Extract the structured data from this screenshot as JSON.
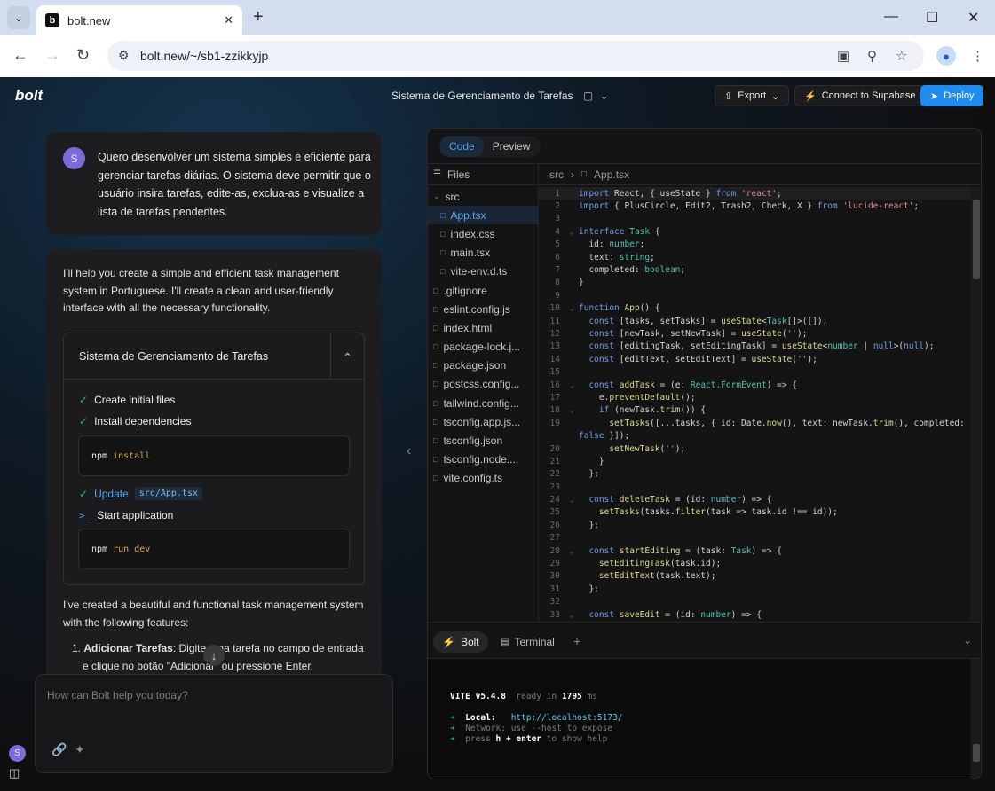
{
  "browser": {
    "tab_title": "bolt.new",
    "favicon_letter": "b",
    "url": "bolt.new/~/sb1-zzikkyjp",
    "new_tab_symbol": "+",
    "profile_initial": "●"
  },
  "app": {
    "logo": "bolt",
    "project_title": "Sistema de Gerenciamento de Tarefas",
    "export_label": "Export",
    "supabase_label": "Connect to Supabase",
    "deploy_label": "Deploy"
  },
  "chat": {
    "user_initial": "S",
    "user_message": "Quero desenvolver um sistema simples e eficiente para gerenciar tarefas diárias. O sistema deve permitir que o usuário insira tarefas, edite-as, exclua-as e visualize a lista de tarefas pendentes.",
    "assistant_intro": "I'll help you create a simple and efficient task management system in Portuguese. I'll create a clean and user-friendly interface with all the necessary functionality.",
    "artifact": {
      "title": "Sistema de Gerenciamento de Tarefas",
      "steps": [
        {
          "label": "Create initial files",
          "status": "done"
        },
        {
          "label": "Install dependencies",
          "status": "done"
        },
        {
          "label": "Update",
          "file": "src/App.tsx",
          "status": "done"
        },
        {
          "label": "Start application",
          "status": "running"
        }
      ],
      "cmd1": {
        "cmd": "npm",
        "args": "install"
      },
      "cmd2": {
        "cmd": "npm",
        "args": "run dev"
      }
    },
    "assistant_after": "I've created a beautiful and functional task management system with the following features:",
    "feature1_bold": "Adicionar Tarefas",
    "feature1_text": ": Digite uma tarefa no campo de entrada e clique no botão \"Adicionar\" ou pressione Enter.",
    "input_placeholder": "How can Bolt help you today?",
    "bottom_avatar": "S"
  },
  "workbench": {
    "tabs": [
      "Code",
      "Preview"
    ],
    "active_tab": "Code",
    "files_label": "Files",
    "tree": [
      {
        "name": "src",
        "type": "folder",
        "indent": 0
      },
      {
        "name": "App.tsx",
        "type": "file",
        "indent": 1,
        "selected": true
      },
      {
        "name": "index.css",
        "type": "file",
        "indent": 1
      },
      {
        "name": "main.tsx",
        "type": "file",
        "indent": 1
      },
      {
        "name": "vite-env.d.ts",
        "type": "file",
        "indent": 1
      },
      {
        "name": ".gitignore",
        "type": "file",
        "indent": 0
      },
      {
        "name": "eslint.config.js",
        "type": "file",
        "indent": 0
      },
      {
        "name": "index.html",
        "type": "file",
        "indent": 0
      },
      {
        "name": "package-lock.j...",
        "type": "file",
        "indent": 0
      },
      {
        "name": "package.json",
        "type": "file",
        "indent": 0
      },
      {
        "name": "postcss.config...",
        "type": "file",
        "indent": 0
      },
      {
        "name": "tailwind.config...",
        "type": "file",
        "indent": 0
      },
      {
        "name": "tsconfig.app.js...",
        "type": "file",
        "indent": 0
      },
      {
        "name": "tsconfig.json",
        "type": "file",
        "indent": 0
      },
      {
        "name": "tsconfig.node....",
        "type": "file",
        "indent": 0
      },
      {
        "name": "vite.config.ts",
        "type": "file",
        "indent": 0
      }
    ],
    "breadcrumb": [
      "src",
      "App.tsx"
    ],
    "code_lines": [
      {
        "n": "1",
        "html": "<span class='kw'>import</span> React, { useState } <span class='kw'>from</span> <span class='str'>'react'</span>;",
        "fold": ""
      },
      {
        "n": "2",
        "html": "<span class='kw'>import</span> { PlusCircle, Edit2, Trash2, Check, X } <span class='kw'>from</span> <span class='str'>'lucide-react'</span>;",
        "fold": ""
      },
      {
        "n": "3",
        "html": "",
        "fold": ""
      },
      {
        "n": "4",
        "html": "<span class='kw'>interface</span> <span class='ty'>Task</span> {",
        "fold": "v"
      },
      {
        "n": "5",
        "html": "  id: <span class='ty'>number</span>;",
        "fold": ""
      },
      {
        "n": "6",
        "html": "  text: <span class='ty'>string</span>;",
        "fold": ""
      },
      {
        "n": "7",
        "html": "  completed: <span class='ty'>boolean</span>;",
        "fold": ""
      },
      {
        "n": "8",
        "html": "}",
        "fold": ""
      },
      {
        "n": "9",
        "html": "",
        "fold": ""
      },
      {
        "n": "10",
        "html": "<span class='kw'>function</span> <span class='fn'>App</span>() {",
        "fold": "v"
      },
      {
        "n": "11",
        "html": "  <span class='kw'>const</span> [tasks, setTasks] = <span class='fn'>useState</span>&lt;<span class='ty'>Task</span>[]&gt;([]);",
        "fold": ""
      },
      {
        "n": "12",
        "html": "  <span class='kw'>const</span> [newTask, setNewTask] = <span class='fn'>useState</span>(<span class='str'>''</span>);",
        "fold": ""
      },
      {
        "n": "13",
        "html": "  <span class='kw'>const</span> [editingTask, setEditingTask] = <span class='fn'>useState</span>&lt;<span class='ty'>number</span> | <span class='kw'>null</span>&gt;(<span class='kw'>null</span>);",
        "fold": ""
      },
      {
        "n": "14",
        "html": "  <span class='kw'>const</span> [editText, setEditText] = <span class='fn'>useState</span>(<span class='str'>''</span>);",
        "fold": ""
      },
      {
        "n": "15",
        "html": "",
        "fold": ""
      },
      {
        "n": "16",
        "html": "  <span class='kw'>const</span> <span class='fn'>addTask</span> = (e: <span class='ty'>React.FormEvent</span>) =&gt; {",
        "fold": "v"
      },
      {
        "n": "17",
        "html": "    e.<span class='fn'>preventDefault</span>();",
        "fold": ""
      },
      {
        "n": "18",
        "html": "    <span class='kw'>if</span> (newTask.<span class='fn'>trim</span>()) {",
        "fold": "v"
      },
      {
        "n": "19",
        "html": "      <span class='fn'>setTasks</span>([...tasks, { id: Date.<span class='fn'>now</span>(), text: newTask.<span class='fn'>trim</span>(), completed:",
        "fold": ""
      },
      {
        "n": "",
        "html": "<span class='kw'>false</span> }]);",
        "fold": ""
      },
      {
        "n": "20",
        "html": "      <span class='fn'>setNewTask</span>(<span class='str'>''</span>);",
        "fold": ""
      },
      {
        "n": "21",
        "html": "    }",
        "fold": ""
      },
      {
        "n": "22",
        "html": "  };",
        "fold": ""
      },
      {
        "n": "23",
        "html": "",
        "fold": ""
      },
      {
        "n": "24",
        "html": "  <span class='kw'>const</span> <span class='fn'>deleteTask</span> = (id: <span class='ty'>number</span>) =&gt; {",
        "fold": "v"
      },
      {
        "n": "25",
        "html": "    <span class='fn'>setTasks</span>(tasks.<span class='fn'>filter</span>(task =&gt; task.id !== id));",
        "fold": ""
      },
      {
        "n": "26",
        "html": "  };",
        "fold": ""
      },
      {
        "n": "27",
        "html": "",
        "fold": ""
      },
      {
        "n": "28",
        "html": "  <span class='kw'>const</span> <span class='fn'>startEditing</span> = (task: <span class='ty'>Task</span>) =&gt; {",
        "fold": "v"
      },
      {
        "n": "29",
        "html": "    <span class='fn'>setEditingTask</span>(task.id);",
        "fold": ""
      },
      {
        "n": "30",
        "html": "    <span class='fn'>setEditText</span>(task.text);",
        "fold": ""
      },
      {
        "n": "31",
        "html": "  };",
        "fold": ""
      },
      {
        "n": "32",
        "html": "",
        "fold": ""
      },
      {
        "n": "33",
        "html": "  <span class='kw'>const</span> <span class='fn'>saveEdit</span> = (id: <span class='ty'>number</span>) =&gt; {",
        "fold": "v"
      }
    ],
    "terminal_tabs": [
      "Bolt",
      "Terminal"
    ],
    "terminal": {
      "vite": "VITE v5.4.8",
      "ready": "ready in",
      "ms_value": "1795",
      "ms_unit": "ms",
      "local_label": "Local:",
      "local_url": "http://localhost:5173/",
      "network_label": "Network:",
      "network_text": "use --host to expose",
      "help_prefix": "press",
      "help_key": "h + enter",
      "help_text": "to show help",
      "arrow": "➜"
    }
  },
  "colors": {
    "accent": "#1d8cf0",
    "success": "#3fb97c",
    "avatar": "#7c6cdb"
  }
}
